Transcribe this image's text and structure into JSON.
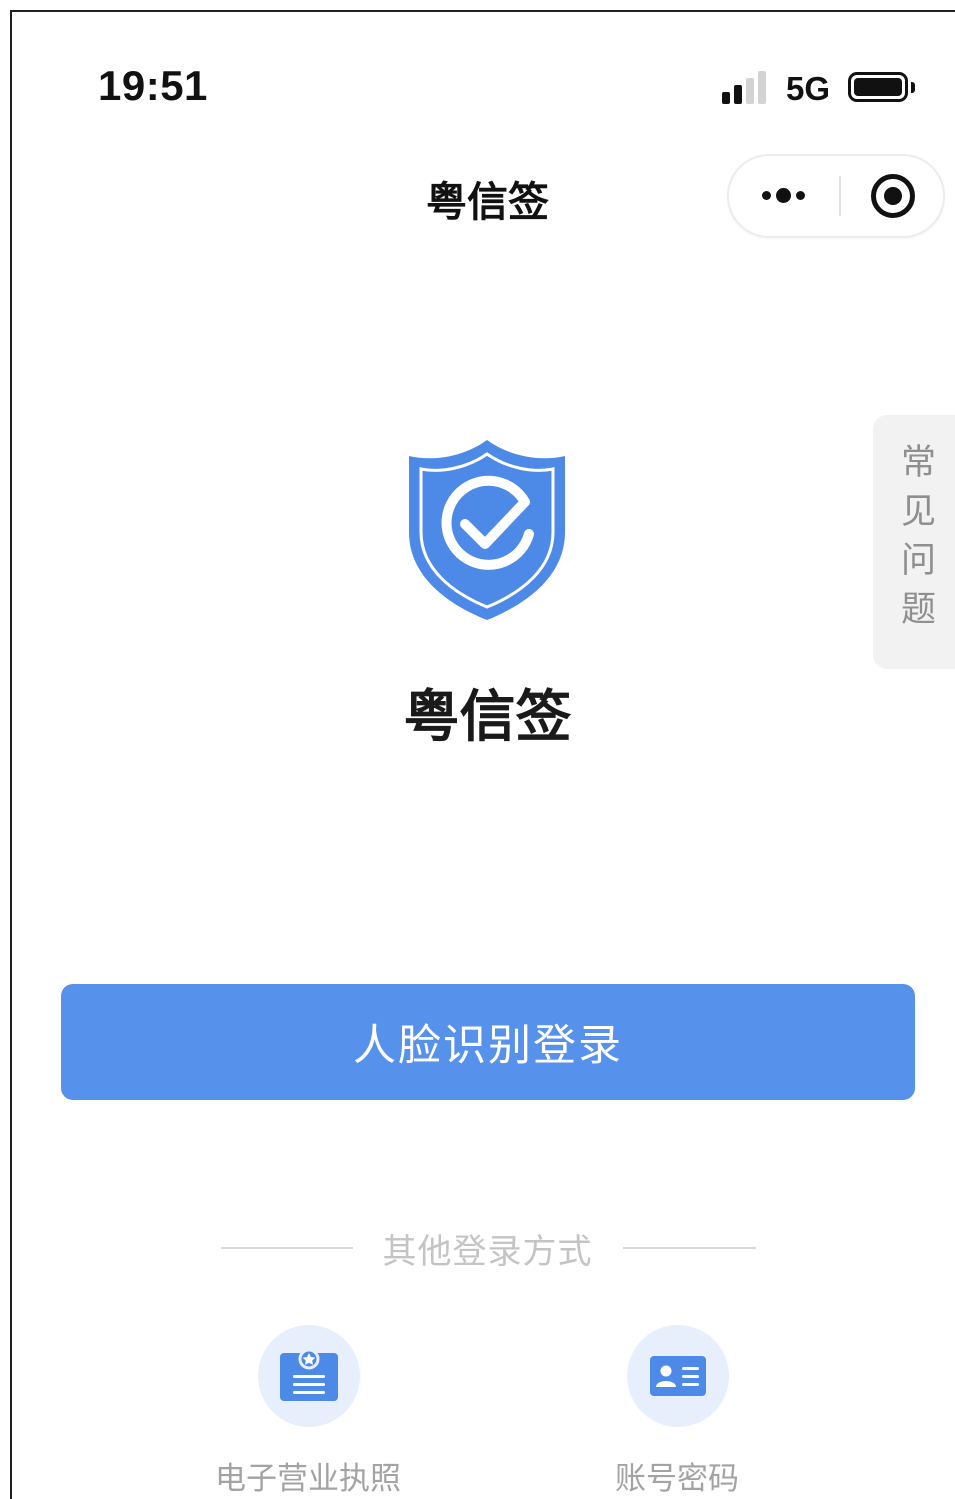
{
  "status_bar": {
    "time": "19:51",
    "network": "5G",
    "signal_bars_filled": 2,
    "signal_bars_total": 4,
    "battery_level": 1.0
  },
  "nav": {
    "title": "粤信签",
    "more_icon": "more-dots-icon",
    "close_icon": "target-icon"
  },
  "faq": {
    "label": "常见问题"
  },
  "brand": {
    "logo_icon": "shield-check-icon",
    "title": "粤信签"
  },
  "primary_action": {
    "label": "人脸识别登录"
  },
  "other_login": {
    "label": "其他登录方式",
    "methods": [
      {
        "label": "电子营业执照",
        "icon": "business-license-icon"
      },
      {
        "label": "账号密码",
        "icon": "account-card-icon"
      }
    ]
  },
  "colors": {
    "accent": "#5692ec",
    "shield": "#4d8ae8",
    "icon_circle_bg": "#e7effc",
    "muted_text": "#a3a3a3"
  }
}
